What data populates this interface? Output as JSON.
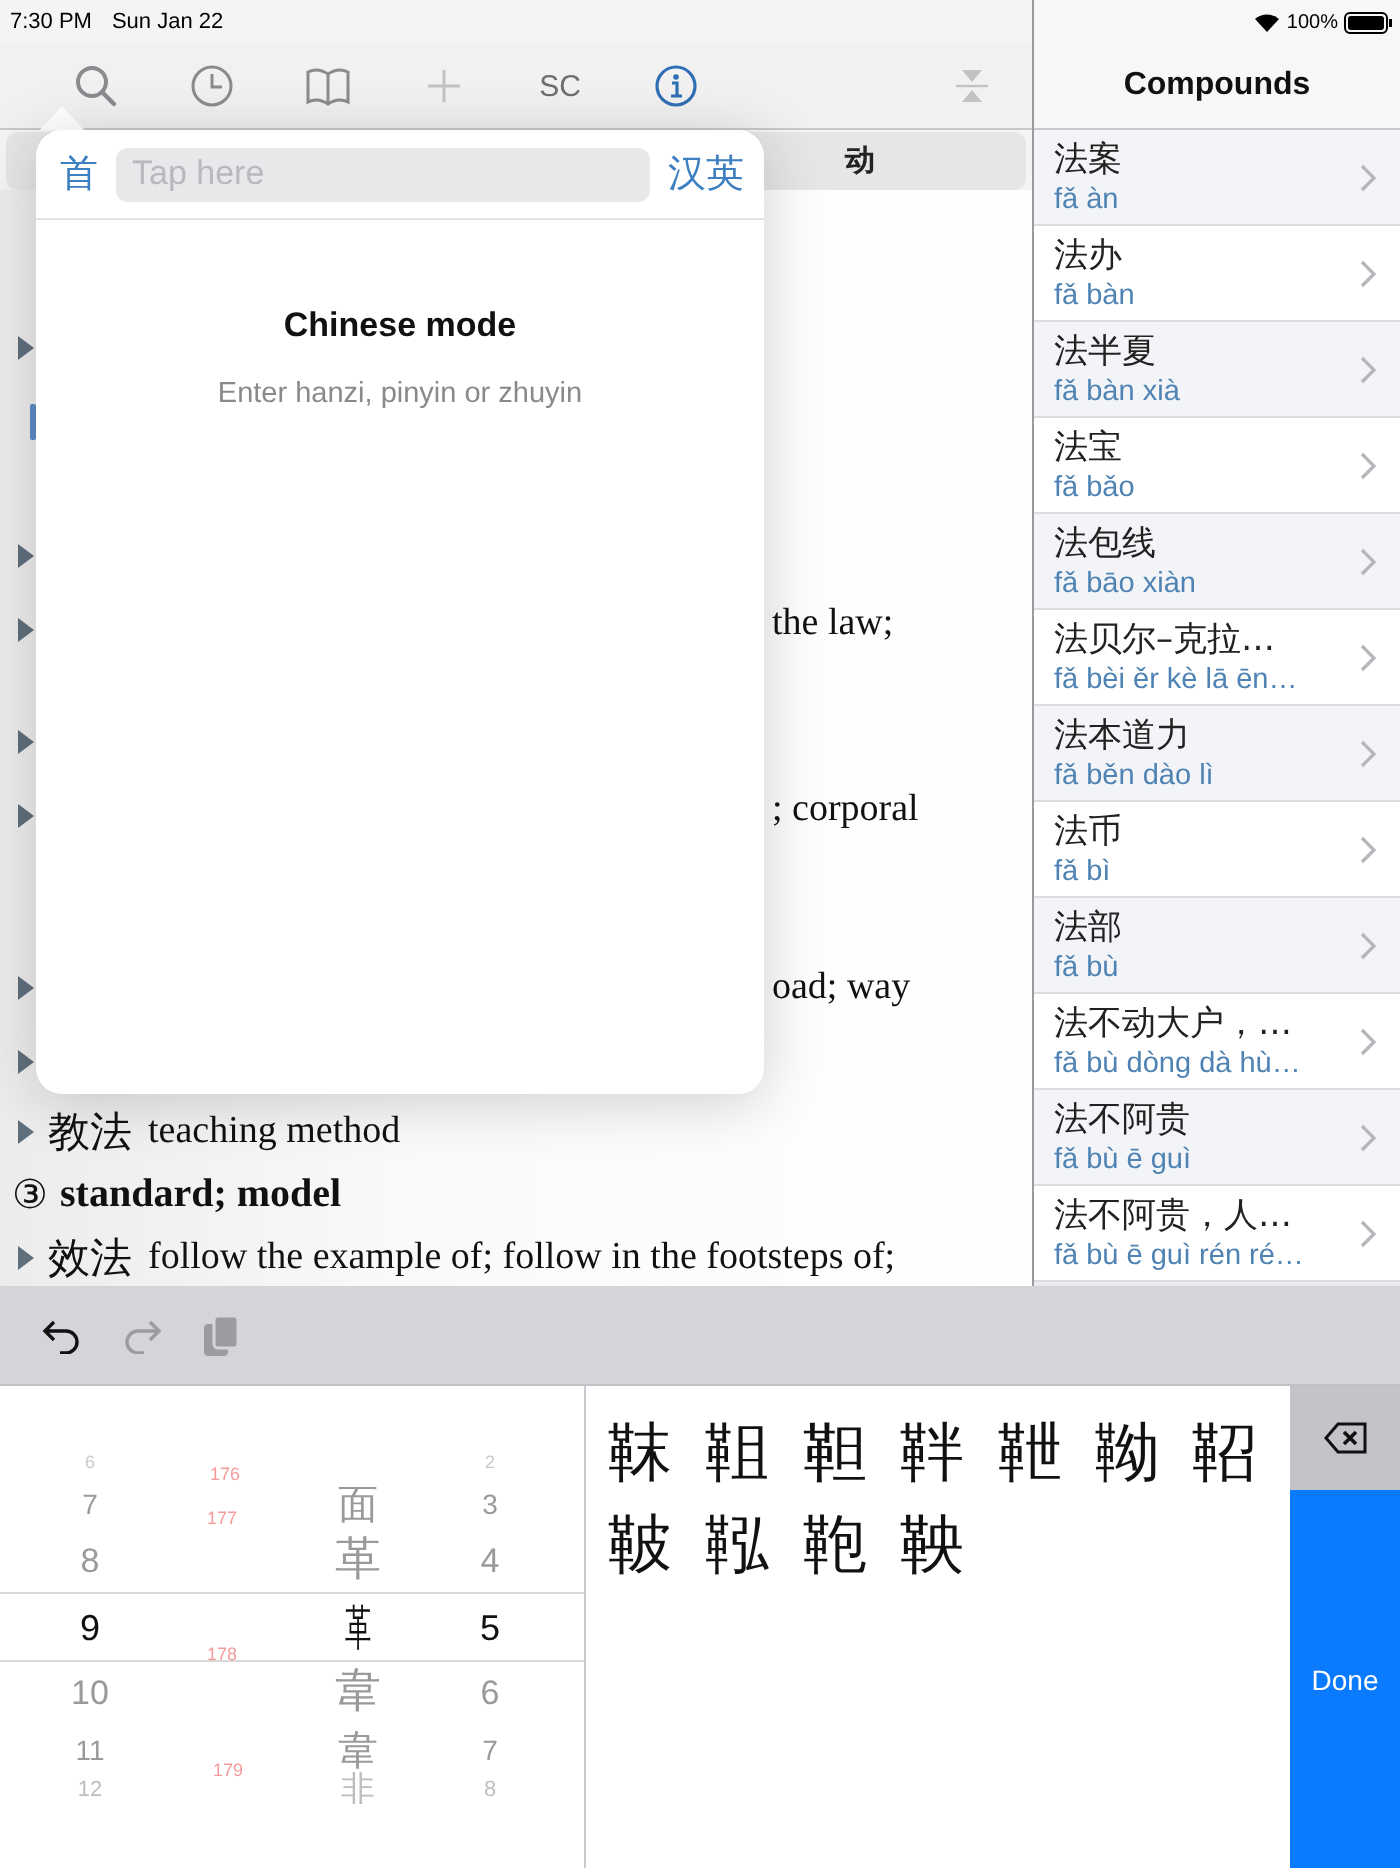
{
  "status_bar": {
    "time": "7:30 PM",
    "date": "Sun Jan 22",
    "battery": "100%"
  },
  "toolbar": [
    {
      "kind": "search",
      "disabled": false,
      "selected": false
    },
    {
      "kind": "history",
      "disabled": false,
      "selected": false
    },
    {
      "kind": "bookmarks",
      "disabled": false,
      "selected": false
    },
    {
      "kind": "add",
      "disabled": true,
      "selected": false
    },
    {
      "kind": "script",
      "label": "SC",
      "disabled": false,
      "selected": false
    },
    {
      "kind": "info",
      "disabled": false,
      "selected": true
    },
    {
      "kind": "collapse",
      "disabled": true,
      "selected": false
    }
  ],
  "segmented": {
    "label": "动"
  },
  "entries": [
    {
      "kind": "marker"
    },
    {
      "kind": "tag"
    },
    {
      "kind": "sense"
    },
    {
      "kind": "marker"
    },
    {
      "kind": "partial",
      "text": "the law;",
      "wraps": true
    },
    {
      "kind": "marker"
    },
    {
      "kind": "partial",
      "text": "; corporal",
      "wraps": true
    },
    {
      "kind": "sense"
    },
    {
      "kind": "partial",
      "text": "oad; way",
      "wraps": false
    },
    {
      "kind": "marker"
    },
    {
      "kind": "example",
      "hanzi": "教法",
      "text": "teaching method"
    },
    {
      "kind": "sense",
      "number": "③",
      "text": "standard; model"
    },
    {
      "kind": "example",
      "hanzi": "效法",
      "text": "follow the example of; follow in the footsteps of;"
    }
  ],
  "popover": {
    "mode_button": "首",
    "search": {
      "placeholder": "Tap here"
    },
    "language_button": "汉英",
    "title": "Chinese mode",
    "hint": "Enter hanzi, pinyin or zhuyin"
  },
  "compounds": {
    "title": "Compounds",
    "rows": [
      {
        "hanzi": "法案",
        "pinyin": "fǎ àn"
      },
      {
        "hanzi": "法办",
        "pinyin": "fǎ bàn"
      },
      {
        "hanzi": "法半夏",
        "pinyin": "fǎ bàn xià"
      },
      {
        "hanzi": "法宝",
        "pinyin": "fǎ bǎo"
      },
      {
        "hanzi": "法包线",
        "pinyin": "fǎ bāo xiàn"
      },
      {
        "hanzi": "法贝尔–克拉…",
        "pinyin": "fǎ bèi ěr kè lā ēn…"
      },
      {
        "hanzi": "法本道力",
        "pinyin": "fǎ běn dào lì"
      },
      {
        "hanzi": "法币",
        "pinyin": "fǎ bì"
      },
      {
        "hanzi": "法部",
        "pinyin": "fǎ bù"
      },
      {
        "hanzi": "法不动大户，…",
        "pinyin": "fǎ bù dòng dà hù…"
      },
      {
        "hanzi": "法不阿贵",
        "pinyin": "fǎ bù ē guì"
      },
      {
        "hanzi": "法不阿贵，人…",
        "pinyin": "fǎ bù ē guì rén ré…"
      }
    ]
  },
  "edit_bar": [
    {
      "kind": "undo",
      "disabled": false
    },
    {
      "kind": "redo",
      "disabled": true
    },
    {
      "kind": "paste",
      "disabled": true
    }
  ],
  "keyboard": {
    "wheels": [
      {
        "kind": "strokes",
        "items": [
          {
            "text": "6",
            "selected": false
          },
          {
            "text": "7",
            "selected": false
          },
          {
            "text": "8",
            "selected": false
          },
          {
            "text": "9",
            "selected": true
          },
          {
            "text": "10",
            "selected": false
          },
          {
            "text": "11",
            "selected": false
          },
          {
            "text": "12",
            "selected": false
          }
        ]
      },
      {
        "kind": "radicals",
        "items": [
          {
            "text": "面",
            "index": "176",
            "selected": false
          },
          {
            "text": "革",
            "index": "177",
            "selected": false
          },
          {
            "text": "革",
            "selected": true
          },
          {
            "text": "韋",
            "index": "178",
            "selected": false
          },
          {
            "text": "韋",
            "selected": false
          },
          {
            "text": "非",
            "index": "179",
            "selected": false
          }
        ]
      },
      {
        "kind": "strokes",
        "items": [
          {
            "text": "2",
            "selected": false
          },
          {
            "text": "3",
            "selected": false
          },
          {
            "text": "4",
            "selected": false
          },
          {
            "text": "5",
            "selected": true
          },
          {
            "text": "6",
            "selected": false
          },
          {
            "text": "7",
            "selected": false
          },
          {
            "text": "8",
            "selected": false
          }
        ]
      }
    ],
    "candidates": [
      "靺",
      "靻",
      "靼",
      "靽",
      "靾",
      "靿",
      "鞀",
      "鞁",
      "鞃",
      "鞄",
      "鞅"
    ],
    "done": "Done"
  }
}
